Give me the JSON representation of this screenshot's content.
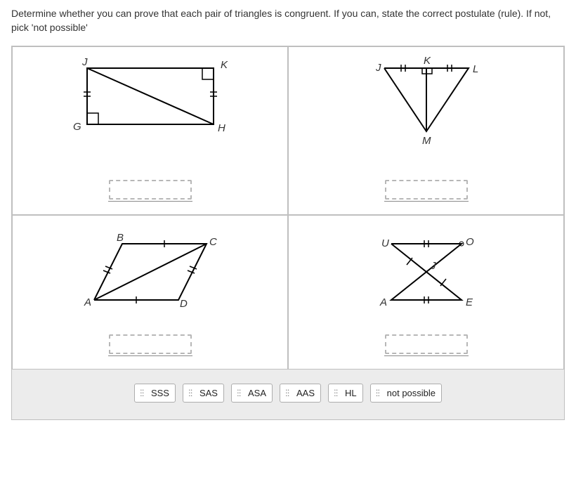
{
  "question": "Determine whether you can prove that each pair of triangles is congruent. If you can, state the correct postulate (rule). If not, pick 'not possible'",
  "figures": {
    "f1": {
      "J": "J",
      "K": "K",
      "G": "G",
      "H": "H"
    },
    "f2": {
      "J": "J",
      "K": "K",
      "L": "L",
      "M": "M"
    },
    "f3": {
      "A": "A",
      "B": "B",
      "C": "C",
      "D": "D"
    },
    "f4": {
      "U": "U",
      "O": "O",
      "A": "A",
      "E": "E",
      "J": "J"
    }
  },
  "chips": [
    "SSS",
    "SAS",
    "ASA",
    "AAS",
    "HL",
    "not possible"
  ]
}
